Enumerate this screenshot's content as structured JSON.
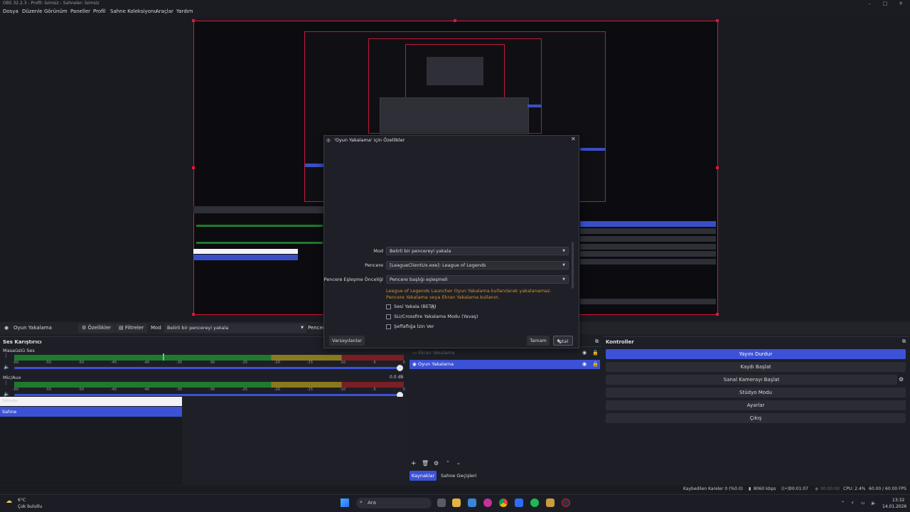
{
  "window": {
    "title": "OBS 32.2.3 - Profil: İsimsiz - Sahneler: İsimsiz"
  },
  "menu": [
    "Dosya",
    "Düzenle",
    "Görünüm",
    "Paneller",
    "Profil",
    "Sahne Koleksiyonu",
    "Araçlar",
    "Yardım"
  ],
  "source_toolbar": {
    "source_name": "Oyun Yakalama",
    "properties_label": "Özellikler",
    "filters_label": "Filtreler",
    "mode_label": "Mod",
    "mode_value": "Belirli bir pencereyi yakala",
    "window_label_partial": "Pencer"
  },
  "audio_mixer": {
    "title": "Ses Karıştırıcı",
    "channels": [
      {
        "name": "Masaüstü Ses",
        "db": "",
        "ticks": [
          "-60",
          "-55",
          "-50",
          "-45",
          "-40",
          "-35",
          "-30",
          "-25",
          "-20",
          "-15",
          "-10",
          "-5",
          "0"
        ]
      },
      {
        "name": "Mic/Aux",
        "db": "0.0 dB",
        "ticks": [
          "-60",
          "-55",
          "-50",
          "-45",
          "-40",
          "-35",
          "-30",
          "-25",
          "-20",
          "-15",
          "-10",
          "-5",
          "0"
        ]
      }
    ]
  },
  "scenes": {
    "header": "Sahneler",
    "items": [
      "Sahne"
    ]
  },
  "sources": {
    "items": [
      {
        "name": "Ekran Yakalama",
        "selected": false
      },
      {
        "name": "Oyun Yakalama",
        "selected": true
      }
    ],
    "tabs": [
      "Kaynaklar",
      "Sahne Geçişleri"
    ]
  },
  "controls": {
    "title": "Kontroller",
    "buttons": [
      "Yayını Durdur",
      "Kaydı Başlat",
      "Sanal Kamerayı Başlat",
      "Stüdyo Modu",
      "Ayarlar",
      "Çıkış"
    ]
  },
  "dialog": {
    "title": "'Oyun Yakalama' için Özellikler",
    "fields": [
      {
        "label": "Mod",
        "value": "Belirli bir pencereyi yakala"
      },
      {
        "label": "Pencere",
        "value": "[LeagueClientUx.exe]: League of Legends"
      },
      {
        "label": "Pencere Eşleşme Önceliği",
        "value": "Pencere başlığı eşleşmeli"
      }
    ],
    "warning_line1": "League of Legends Launcher Oyun Yakalama kullanılarak yakalanamaz.",
    "warning_line2": "Pencere Yakalama veya Ekran Yakalama kullanın.",
    "checkboxes": [
      {
        "label": "Sesi Yakala (BETA)",
        "checked": false
      },
      {
        "label": "SLI/Crossfire Yakalama Modu (Yavaş)",
        "checked": false
      },
      {
        "label": "Şeffaflığa İzin Ver",
        "checked": false
      }
    ],
    "defaults_button": "Varsayılanlar",
    "ok_button": "Tamam",
    "cancel_button": "İptal"
  },
  "status": {
    "dropped_frames": "Kaybedilen Kareler 0 (%0.0)",
    "bitrate": "8060 kbps",
    "stream_time": "00:01:07",
    "record_time": "00:00:00",
    "cpu": "CPU: 2.4%",
    "fps": "60.00 / 60.00 FPS"
  },
  "taskbar": {
    "weather_temp": "6°C",
    "weather_desc": "Çok bulutlu",
    "search_placeholder": "Ara",
    "time": "13:32",
    "date": "14.01.2026"
  },
  "colors": {
    "accent": "#3c52d6",
    "selection_red": "#d6163a",
    "warning": "#d6912c"
  }
}
